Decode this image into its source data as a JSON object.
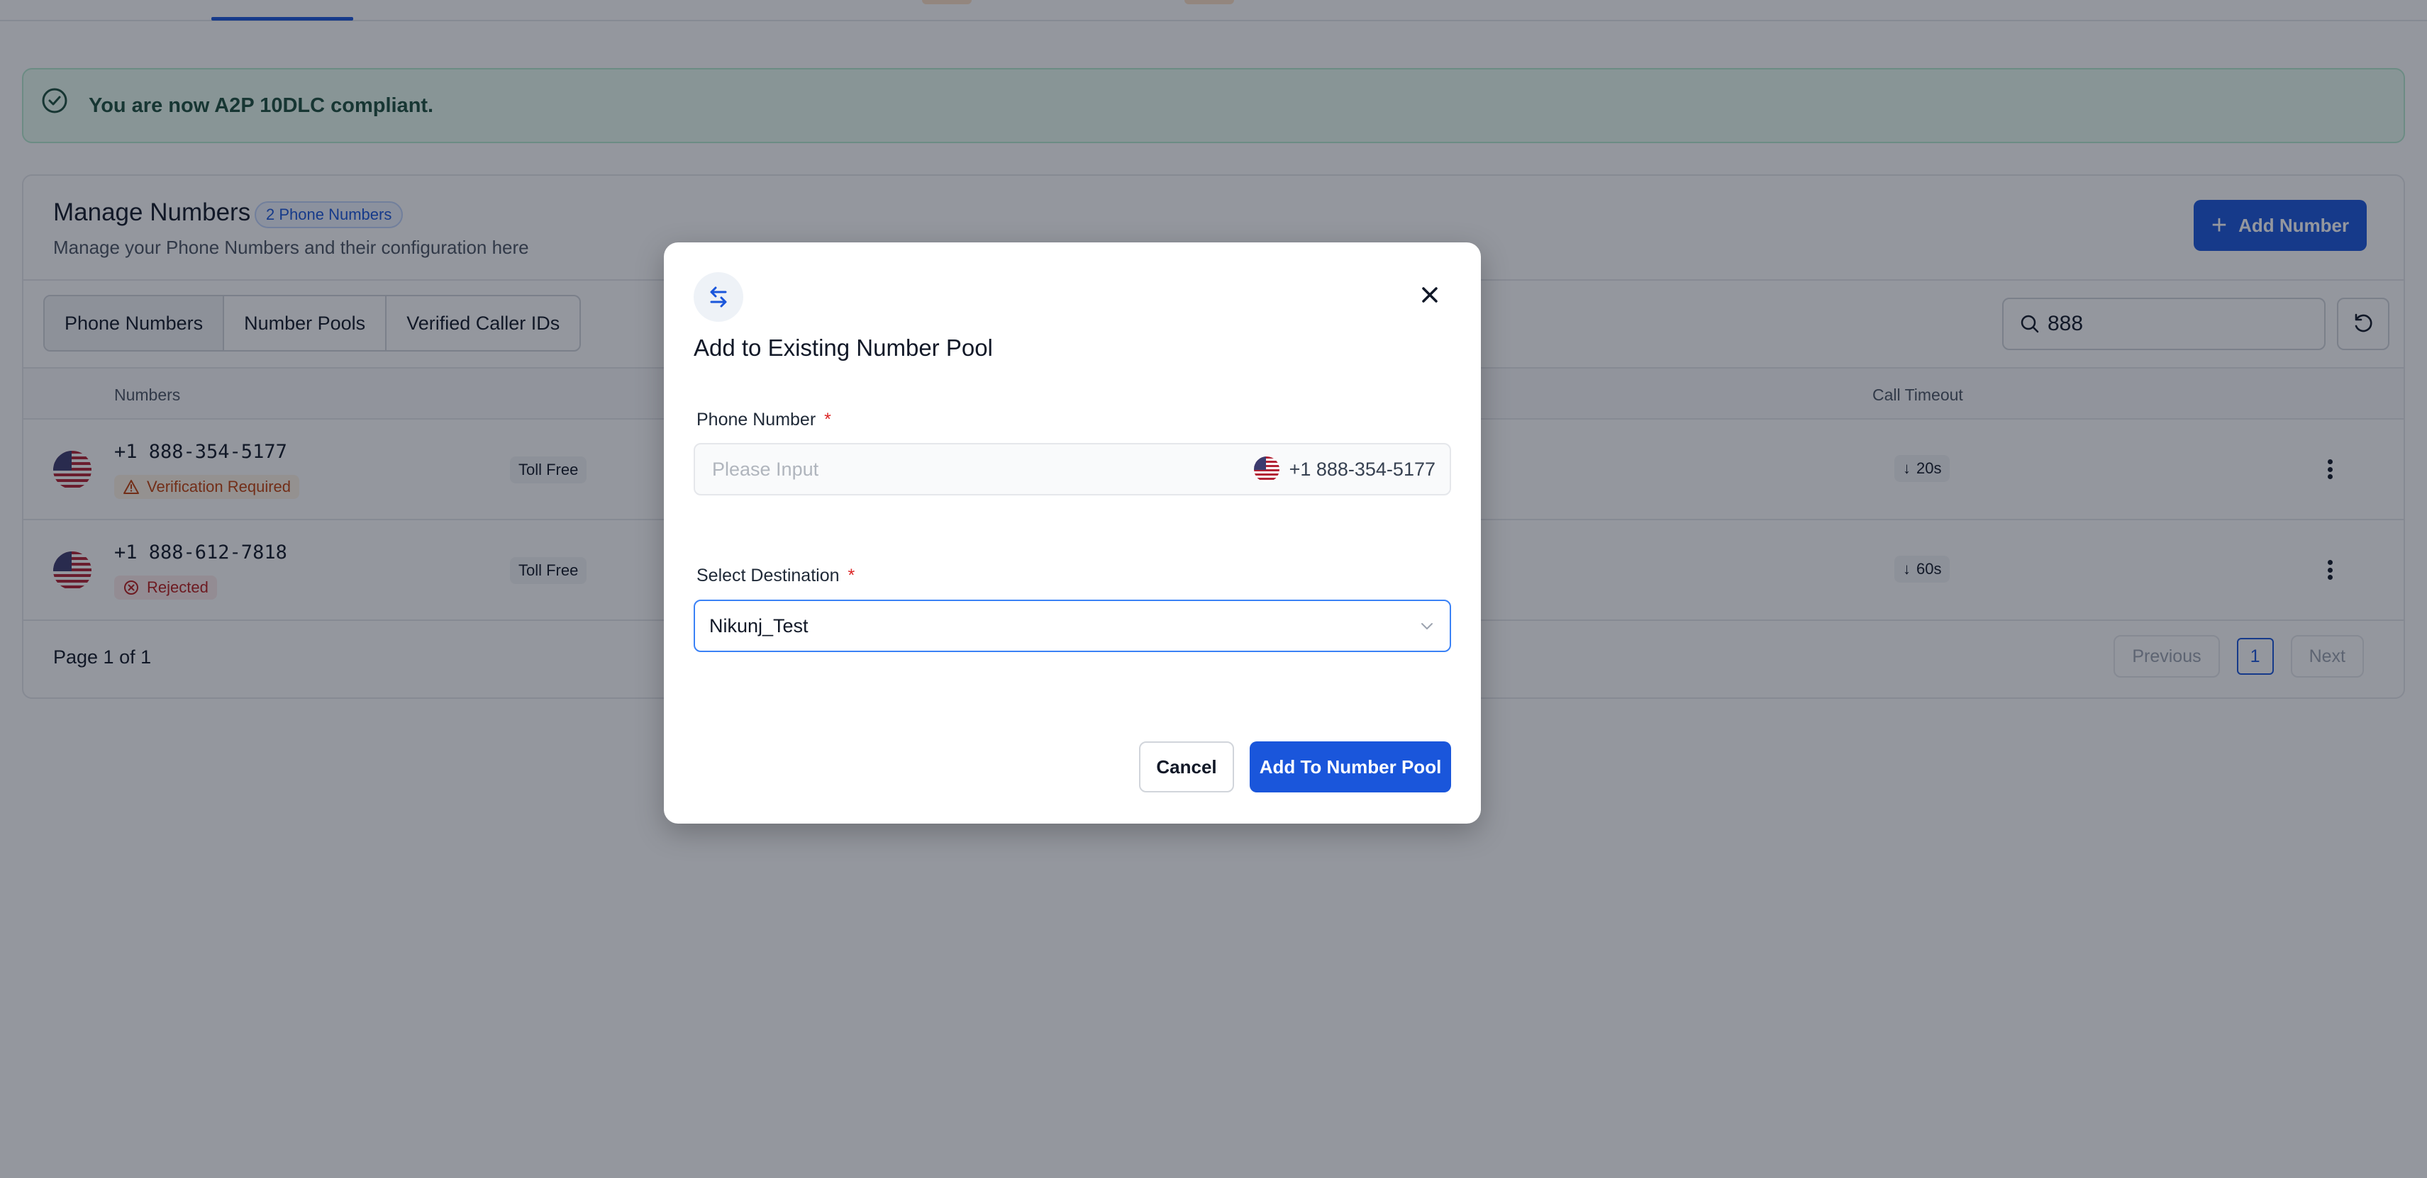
{
  "banner": {
    "text": "You are now A2P 10DLC compliant."
  },
  "card": {
    "title": "Manage Numbers",
    "count_badge": "2 Phone Numbers",
    "subtitle": "Manage your Phone Numbers and their configuration here",
    "add_button": "Add Number"
  },
  "tabs": [
    {
      "label": "Phone Numbers",
      "active": true
    },
    {
      "label": "Number Pools",
      "active": false
    },
    {
      "label": "Verified Caller IDs",
      "active": false
    }
  ],
  "search": {
    "value": "888",
    "icon": "search-icon"
  },
  "table": {
    "columns": [
      "Numbers",
      "Call Timeout"
    ],
    "rows": [
      {
        "number": "+1 888-354-5177",
        "status": "Verification Required",
        "status_kind": "warning",
        "type": "Toll Free",
        "timeout": "20s"
      },
      {
        "number": "+1 888-612-7818",
        "status": "Rejected",
        "status_kind": "error",
        "type": "Toll Free",
        "timeout": "60s"
      }
    ]
  },
  "pagination": {
    "info": "Page 1 of 1",
    "previous": "Previous",
    "current": "1",
    "next": "Next"
  },
  "modal": {
    "title": "Add to Existing Number Pool",
    "phone_label": "Phone Number",
    "phone_required_mark": "*",
    "phone_placeholder": "Please Input",
    "phone_value": "+1 888-354-5177",
    "destination_label": "Select Destination",
    "destination_required_mark": "*",
    "destination_value": "Nikunj_Test",
    "cancel": "Cancel",
    "submit": "Add To Number Pool"
  },
  "colors": {
    "primary": "#1a56db",
    "success_bg": "#eafbf1",
    "warning": "#c2410c",
    "error": "#b91c1c",
    "overlay": "rgba(17,24,39,0.45)"
  }
}
